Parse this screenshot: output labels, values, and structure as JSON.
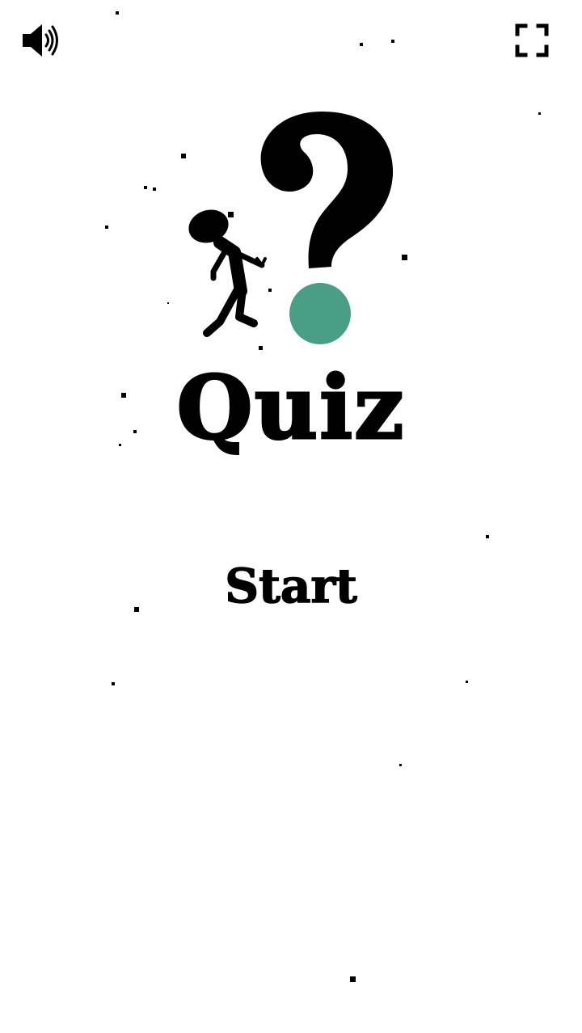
{
  "toolbar": {
    "sound_icon": "speaker-volume-icon",
    "fullscreen_icon": "fullscreen-icon"
  },
  "logo": {
    "figure": "stick-figure-silhouette",
    "mark": "question-mark",
    "dot_color": "#4a9e86"
  },
  "title": "Quiz",
  "start_label": "Start"
}
